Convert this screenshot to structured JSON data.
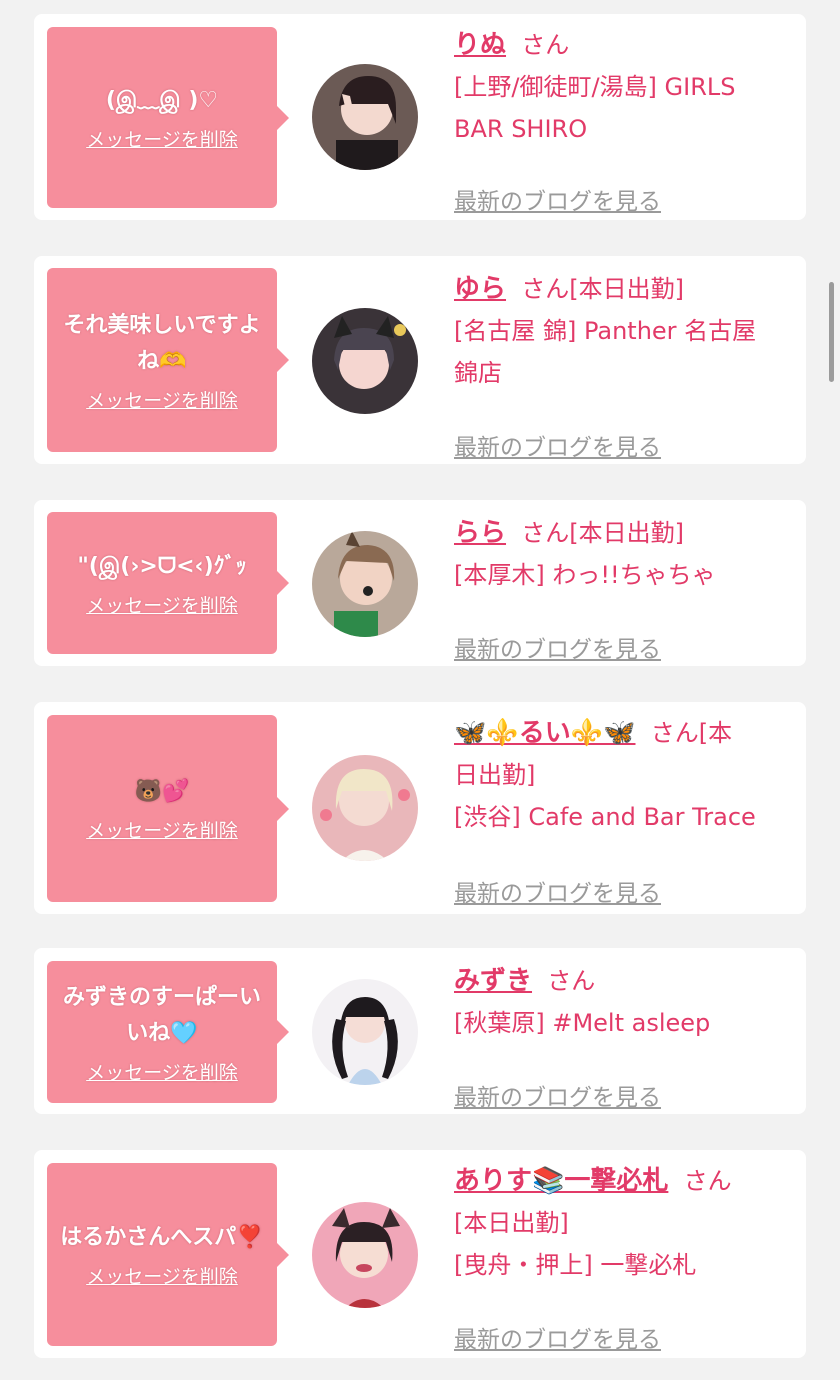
{
  "delete_label": "メッセージを削除",
  "blog_label": "最新のブログを見る",
  "san_label": "さん",
  "cards": [
    {
      "message": "(இ﹏இ )♡",
      "name": "りぬ",
      "suffix": "さん",
      "lines": [
        "[上野/御徒町/湯島] GIRLS",
        "BAR SHIRO"
      ]
    },
    {
      "message": "それ美味しいですよね🫶",
      "name": "ゆら",
      "suffix": "さん[本日出勤]",
      "lines": [
        "[名古屋 錦] Panther 名古屋",
        "錦店"
      ]
    },
    {
      "message": "\"(இ(›>ᗜ<‹)ｸﾞｯ",
      "name": "らら",
      "suffix": "さん[本日出勤]",
      "lines": [
        "[本厚木] わっ!!ちゃちゃ"
      ]
    },
    {
      "message": "🐻💕",
      "name": "🦋⚜️るい⚜️🦋",
      "suffix": "さん[本",
      "lines": [
        "日出勤]",
        "[渋谷] Cafe and Bar Trace"
      ]
    },
    {
      "message": "みずきのすーぱーいいね🩵",
      "name": "みずき",
      "suffix": "さん",
      "lines": [
        "[秋葉原] #Melt asleep"
      ]
    },
    {
      "message": "はるかさんへスパ❣️",
      "name": "ありす📚一撃必札",
      "suffix": "さん",
      "lines": [
        "[本日出勤]",
        "[曳舟・押上] 一撃必札"
      ]
    }
  ]
}
